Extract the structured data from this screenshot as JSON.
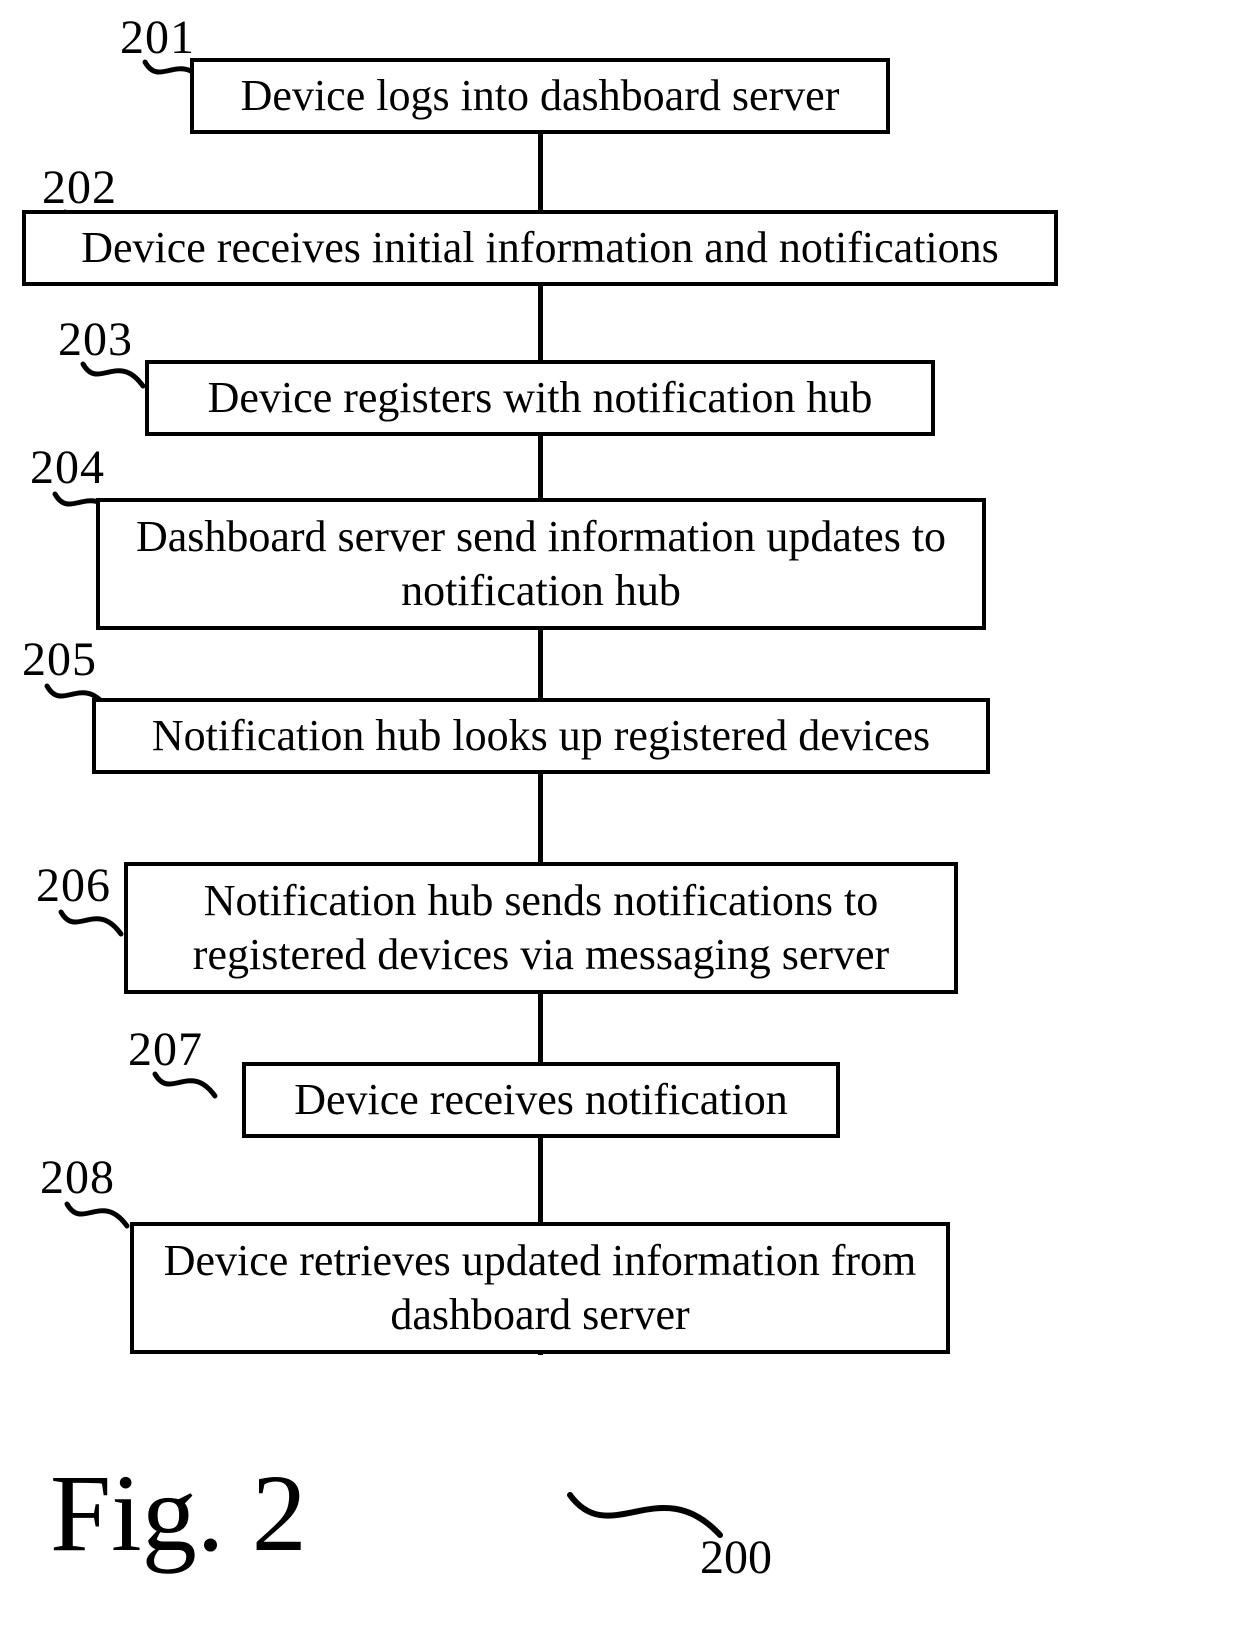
{
  "flow": {
    "steps": [
      {
        "num": "201",
        "text": "Device logs into dashboard server"
      },
      {
        "num": "202",
        "text": "Device receives initial information and notifications"
      },
      {
        "num": "203",
        "text": "Device registers with notification hub"
      },
      {
        "num": "204",
        "text": "Dashboard server send information updates to notification hub"
      },
      {
        "num": "205",
        "text": "Notification hub looks up registered devices"
      },
      {
        "num": "206",
        "text": "Notification hub sends notifications to registered devices via messaging server"
      },
      {
        "num": "207",
        "text": "Device receives notification"
      },
      {
        "num": "208",
        "text": "Device retrieves updated information from dashboard server"
      }
    ],
    "figure_label": "Fig. 2",
    "figure_ref": "200"
  }
}
